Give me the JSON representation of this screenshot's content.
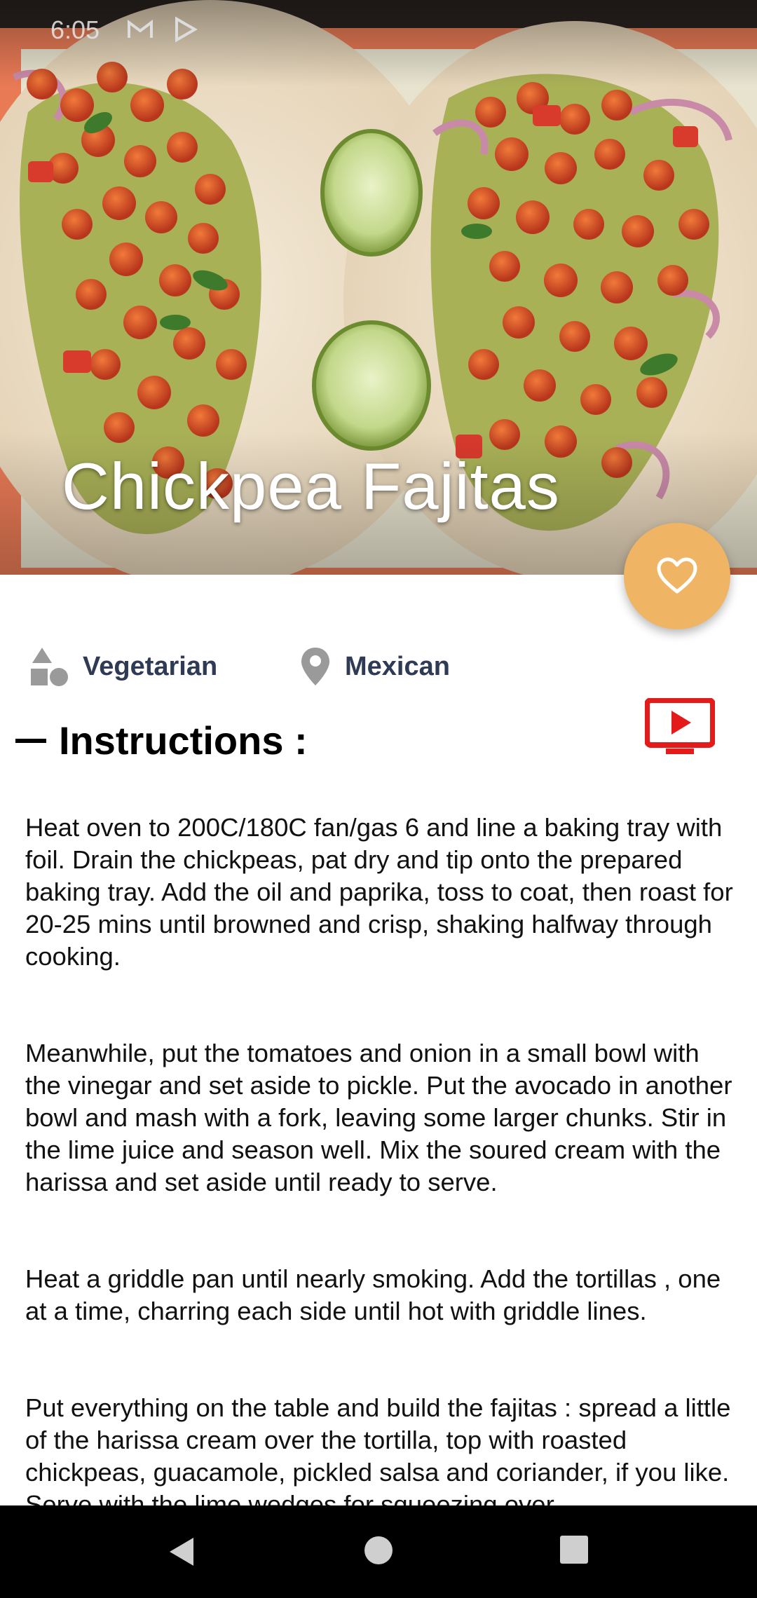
{
  "status_bar": {
    "time": "6:05",
    "icons": [
      "gmail-icon",
      "play-store-icon"
    ]
  },
  "recipe": {
    "title": "Chickpea Fajitas",
    "category": "Vegetarian",
    "area": "Mexican",
    "favorite_icon": "heart-outline-icon",
    "video_icon": "youtube-play-icon"
  },
  "instructions": {
    "heading": "Instructions :",
    "paragraphs": [
      "Heat oven to 200C/180C fan/gas 6 and line a baking tray with foil. Drain the chickpeas, pat dry and tip onto the prepared baking tray. Add the oil and paprika, toss to coat, then roast for 20-25 mins until browned and crisp, shaking halfway through cooking.",
      "Meanwhile, put the tomatoes and onion in a small bowl with the vinegar and set aside to pickle. Put the avocado in another bowl and mash with a fork, leaving some larger chunks. Stir in the lime juice and season well. Mix the soured cream with the harissa and set aside until ready to serve.",
      "Heat a griddle pan until nearly smoking. Add the tortillas , one at a time, charring each side until hot with griddle lines.",
      "Put everything on the table and build the fajitas : spread a little of the harissa cream over the tortilla, top with roasted chickpeas, guacamole, pickled salsa and coriander, if you like. Serve with the lime wedges for squeezing over."
    ]
  },
  "colors": {
    "fab": "#f0b465",
    "tag_text": "#2f3a55",
    "youtube_red": "#e31b1b"
  },
  "nav": [
    "back-icon",
    "home-icon",
    "recents-icon"
  ]
}
